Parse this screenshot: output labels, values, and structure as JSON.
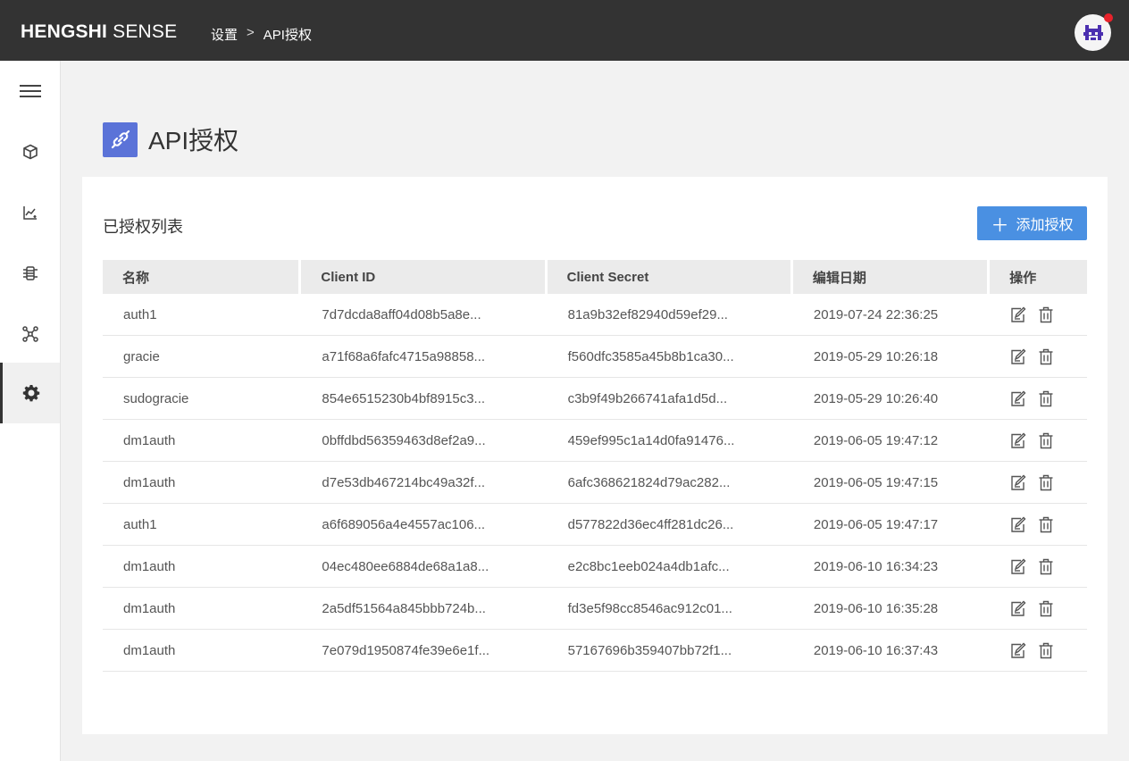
{
  "header": {
    "brand_bold": "HENGSHI",
    "brand_light": "SENSE",
    "breadcrumb": [
      "设置",
      ">",
      "API授权"
    ]
  },
  "sidebar": {
    "items": [
      {
        "icon": "menu-icon"
      },
      {
        "icon": "cube-icon"
      },
      {
        "icon": "chart-icon"
      },
      {
        "icon": "data-connection-icon"
      },
      {
        "icon": "network-icon"
      },
      {
        "icon": "gear-icon",
        "active": true
      }
    ]
  },
  "page": {
    "title": "API授权",
    "title_icon": "link-icon"
  },
  "card": {
    "list_title": "已授权列表",
    "add_button": "添加授权",
    "add_icon": "＋"
  },
  "table": {
    "columns": [
      "名称",
      "Client ID",
      "Client Secret",
      "编辑日期",
      "操作"
    ],
    "rows": [
      {
        "name": "auth1",
        "client_id": "7d7dcda8aff04d08b5a8e...",
        "client_secret": "81a9b32ef82940d59ef29...",
        "date": "2019-07-24 22:36:25"
      },
      {
        "name": "gracie",
        "client_id": "a71f68a6fafc4715a98858...",
        "client_secret": "f560dfc3585a45b8b1ca30...",
        "date": "2019-05-29 10:26:18"
      },
      {
        "name": "sudogracie",
        "client_id": "854e6515230b4bf8915c3...",
        "client_secret": "c3b9f49b266741afa1d5d...",
        "date": "2019-05-29 10:26:40"
      },
      {
        "name": "dm1auth",
        "client_id": "0bffdbd56359463d8ef2a9...",
        "client_secret": "459ef995c1a14d0fa91476...",
        "date": "2019-06-05 19:47:12"
      },
      {
        "name": "dm1auth",
        "client_id": "d7e53db467214bc49a32f...",
        "client_secret": "6afc368621824d79ac282...",
        "date": "2019-06-05 19:47:15"
      },
      {
        "name": "auth1",
        "client_id": "a6f689056a4e4557ac106...",
        "client_secret": "d577822d36ec4ff281dc26...",
        "date": "2019-06-05 19:47:17"
      },
      {
        "name": "dm1auth",
        "client_id": "04ec480ee6884de68a1a8...",
        "client_secret": "e2c8bc1eeb024a4db1afc...",
        "date": "2019-06-10 16:34:23"
      },
      {
        "name": "dm1auth",
        "client_id": "2a5df51564a845bbb724b...",
        "client_secret": "fd3e5f98cc8546ac912c01...",
        "date": "2019-06-10 16:35:28"
      },
      {
        "name": "dm1auth",
        "client_id": "7e079d1950874fe39e6e1f...",
        "client_secret": "57167696b359407bb72f1...",
        "date": "2019-06-10 16:37:43"
      }
    ]
  },
  "colors": {
    "header_bg": "#333333",
    "accent": "#4a90e2",
    "title_icon_bg": "#5b73d8",
    "notification_dot": "#e8222b"
  }
}
